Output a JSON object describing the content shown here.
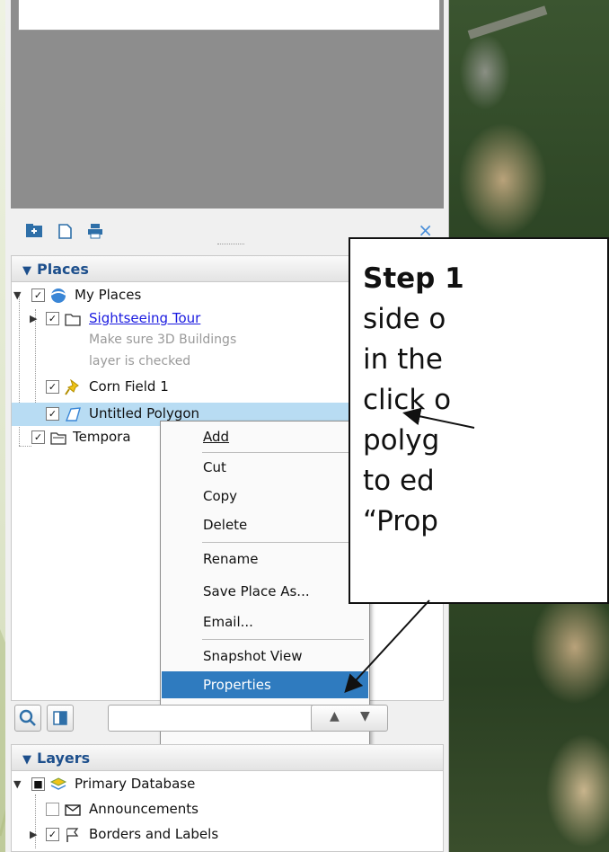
{
  "panel": {
    "toolbar_close": "×",
    "places_header": "Places",
    "layers_header": "Layers"
  },
  "places": {
    "my_places": "My Places",
    "sightseeing_tour": "Sightseeing Tour",
    "sightseeing_desc_1": "Make sure 3D Buildings",
    "sightseeing_desc_2": "layer is checked",
    "corn_field": "Corn Field 1",
    "untitled_polygon": "Untitled Polygon",
    "temporary": "Tempora"
  },
  "context_menu": {
    "add": "Add",
    "cut": "Cut",
    "copy": "Copy",
    "delete": "Delete",
    "rename": "Rename",
    "save_place_as": "Save Place As...",
    "email": "Email...",
    "snapshot_view": "Snapshot View",
    "properties": "Properties"
  },
  "layers": {
    "primary_database": "Primary Database",
    "announcements": "Announcements",
    "borders_labels": "Borders and Labels"
  },
  "callout": {
    "step": "Step 1",
    "line1": "side o",
    "line2": "in the",
    "line3": "click o",
    "line4": "polyg",
    "line5": "to ed",
    "line6": "“Prop"
  },
  "colors": {
    "selection": "#b8dcf3",
    "menu_highlight": "#2f7bbf",
    "link": "#1a1ae0",
    "header_text": "#1d4f8c"
  }
}
